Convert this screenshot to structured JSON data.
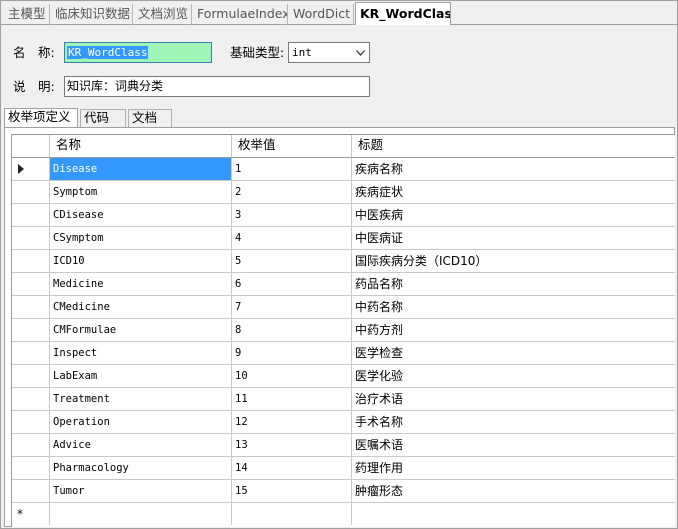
{
  "doc_tabs": [
    {
      "label": "主模型",
      "active": false
    },
    {
      "label": "临床知识数据",
      "active": false
    },
    {
      "label": "文档浏览",
      "active": false
    },
    {
      "label": "FormulaeIndex",
      "active": false
    },
    {
      "label": "WordDict",
      "active": false
    },
    {
      "label": "KR_WordClass",
      "active": true
    }
  ],
  "form": {
    "name_label": "名　称:",
    "name_value": "KR_WordClass",
    "base_type_label": "基础类型:",
    "base_type_value": "int",
    "desc_label": "说　明:",
    "desc_value": "知识库：词典分类"
  },
  "inner_tabs": [
    {
      "label": "枚举项定义",
      "active": true
    },
    {
      "label": "代码",
      "active": false
    },
    {
      "label": "文档",
      "active": false
    }
  ],
  "grid": {
    "columns": [
      "名称",
      "枚举值",
      "标题"
    ],
    "rows": [
      {
        "name": "Disease",
        "value": "1",
        "title": "疾病名称"
      },
      {
        "name": "Symptom",
        "value": "2",
        "title": "疾病症状"
      },
      {
        "name": "CDisease",
        "value": "3",
        "title": "中医疾病"
      },
      {
        "name": "CSymptom",
        "value": "4",
        "title": "中医病证"
      },
      {
        "name": "ICD10",
        "value": "5",
        "title": "国际疾病分类（ICD10）"
      },
      {
        "name": "Medicine",
        "value": "6",
        "title": "药品名称"
      },
      {
        "name": "CMedicine",
        "value": "7",
        "title": "中药名称"
      },
      {
        "name": "CMFormulae",
        "value": "8",
        "title": "中药方剂"
      },
      {
        "name": "Inspect",
        "value": "9",
        "title": "医学检查"
      },
      {
        "name": "LabExam",
        "value": "10",
        "title": "医学化验"
      },
      {
        "name": "Treatment",
        "value": "11",
        "title": "治疗术语"
      },
      {
        "name": "Operation",
        "value": "12",
        "title": "手术名称"
      },
      {
        "name": "Advice",
        "value": "13",
        "title": "医嘱术语"
      },
      {
        "name": "Pharmacology",
        "value": "14",
        "title": "药理作用"
      },
      {
        "name": "Tumor",
        "value": "15",
        "title": "肿瘤形态"
      }
    ],
    "new_row_marker": "*",
    "current_row_icon": "row-pointer-icon"
  },
  "colors": {
    "selection": "#3399ff",
    "focused_field": "#9ff5b6"
  }
}
